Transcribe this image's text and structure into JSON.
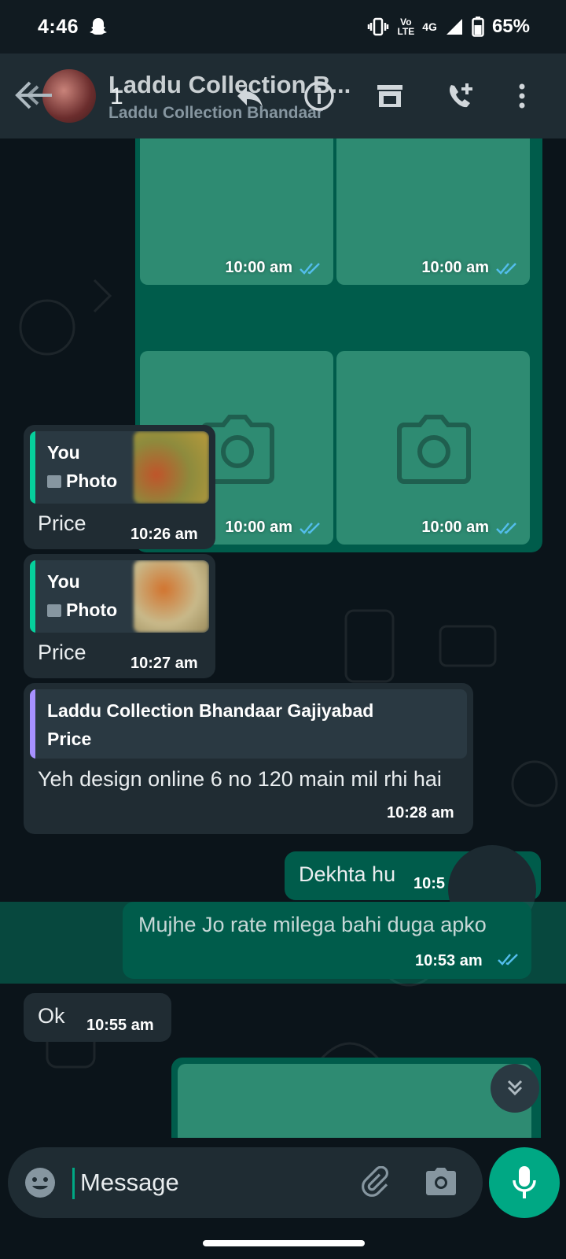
{
  "status_bar": {
    "time": "4:46",
    "network_top": "Vo",
    "network_bottom": "LTE",
    "network_type": "4G",
    "battery": "65%",
    "icons": [
      "snapchat-ghost-icon",
      "vibrate-icon",
      "volte-icon",
      "signal-icon",
      "battery-icon"
    ]
  },
  "header": {
    "contact_name": "Laddu Collection B...",
    "contact_subtitle": "Laddu Collection Bhandaar",
    "selected_count": "1",
    "icons": [
      "back-arrow-icon",
      "reply-icon",
      "info-icon",
      "store-icon",
      "add-call-icon",
      "more-vert-icon"
    ]
  },
  "photo_grid": {
    "timestamps": [
      "10:00 am",
      "10:00 am",
      "10:00 am",
      "10:00 am"
    ],
    "status": "read"
  },
  "messages": [
    {
      "direction": "in",
      "quote_author": "You",
      "quote_type": "Photo",
      "text": "Price",
      "time": "10:26 am"
    },
    {
      "direction": "in",
      "quote_author": "You",
      "quote_type": "Photo",
      "text": "Price",
      "time": "10:27 am"
    },
    {
      "direction": "in",
      "quote_author": "Laddu Collection Bhandaar Gajiyabad",
      "quote_text": "Price",
      "text": "Yeh design online 6 no 120 main mil rhi hai",
      "time": "10:28 am"
    },
    {
      "direction": "out",
      "text": "Dekhta hu",
      "time": "10:5"
    },
    {
      "direction": "out",
      "text": "Mujhe Jo rate milega bahi duga apko",
      "time": "10:53 am",
      "selected": true
    },
    {
      "direction": "in",
      "text": "Ok",
      "time": "10:55 am"
    }
  ],
  "composer": {
    "placeholder": "Message"
  },
  "colors": {
    "outgoing_bubble": "#005c4b",
    "incoming_bubble": "#202c33",
    "accent": "#00a884",
    "read_tick": "#53bdeb",
    "quote_bar_you": "#06cf9c",
    "quote_bar_contact": "#a791ff"
  }
}
